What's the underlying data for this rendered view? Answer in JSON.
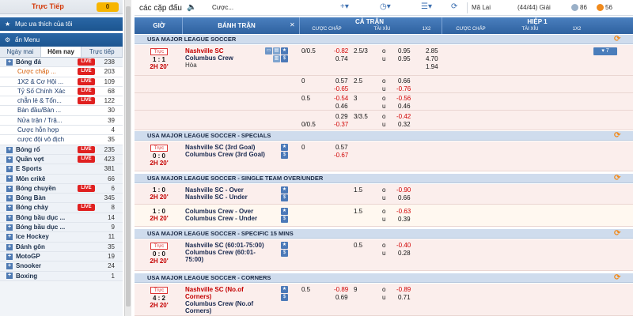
{
  "sidebar": {
    "live_tab": {
      "label": "Trực Tiếp",
      "count": "0"
    },
    "favorites_label": "Mục ưa thích của tôi",
    "menu_label": "ẩn Menu",
    "tabs": [
      "Ngày mai",
      "Hôm nay",
      "Trực tiếp"
    ],
    "sports": [
      {
        "label": "Bóng đá",
        "count": "238",
        "live": "LIVE",
        "kind": "main"
      },
      {
        "label": "Cược chấp ...",
        "count": "203",
        "live": "LIVE",
        "kind": "sub-active"
      },
      {
        "label": "1X2 & Cơ Hội ...",
        "count": "109",
        "live": "LIVE",
        "kind": "sub"
      },
      {
        "label": "Tỷ Số Chính Xác",
        "count": "68",
        "live": "LIVE",
        "kind": "sub"
      },
      {
        "label": "chẵn lẻ & Tổn...",
        "count": "122",
        "live": "LIVE",
        "kind": "sub"
      },
      {
        "label": "Bàn đầu/Bàn ...",
        "count": "30",
        "live": "",
        "kind": "sub"
      },
      {
        "label": "Nửa trận / Trậ...",
        "count": "39",
        "live": "",
        "kind": "sub"
      },
      {
        "label": "Cược hỗn hợp",
        "count": "4",
        "live": "",
        "kind": "sub"
      },
      {
        "label": "cược đội vô địch",
        "count": "35",
        "live": "",
        "kind": "sub"
      },
      {
        "label": "Bóng rổ",
        "count": "235",
        "live": "LIVE",
        "kind": "main"
      },
      {
        "label": "Quần vợt",
        "count": "423",
        "live": "LIVE",
        "kind": "main"
      },
      {
        "label": "E Sports",
        "count": "381",
        "live": "",
        "kind": "main"
      },
      {
        "label": "Môn crikê",
        "count": "66",
        "live": "",
        "kind": "main"
      },
      {
        "label": "Bóng chuyền",
        "count": "6",
        "live": "LIVE",
        "kind": "main"
      },
      {
        "label": "Bóng Bàn",
        "count": "345",
        "live": "",
        "kind": "main"
      },
      {
        "label": "Bóng chày",
        "count": "8",
        "live": "LIVE",
        "kind": "main"
      },
      {
        "label": "Bóng bầu dục ...",
        "count": "14",
        "live": "",
        "kind": "main"
      },
      {
        "label": "Bóng bầu dục ...",
        "count": "9",
        "live": "",
        "kind": "main"
      },
      {
        "label": "Ice Hockey",
        "count": "11",
        "live": "",
        "kind": "main"
      },
      {
        "label": "Đánh gôn",
        "count": "35",
        "live": "",
        "kind": "main"
      },
      {
        "label": "MotoGP",
        "count": "19",
        "live": "",
        "kind": "main"
      },
      {
        "label": "Snooker",
        "count": "24",
        "live": "",
        "kind": "main"
      },
      {
        "label": "Boxing",
        "count": "1",
        "live": "",
        "kind": "main"
      }
    ]
  },
  "topbar": {
    "title": "các cặp đấu",
    "bet_select": "Cược...",
    "odds_type": "Mã Lai",
    "match_count": "(44/44) Giải",
    "badge1": "86",
    "badge2": "56"
  },
  "header": {
    "time": "GIỜ",
    "match": "BÁNH TRẬN",
    "full_time": "CẢ TRẬN",
    "first_half": "HIỆP 1",
    "handicap": "CƯỢC CHẤP",
    "over_under": "TÀI XỈU",
    "one_x_two": "1X2",
    "handicap_h1": "CƯỢC CHẤP",
    "over_under_h1": "TÀI XỈU",
    "one_x_two_h1": "1X2"
  },
  "leagues": [
    {
      "name": "USA MAJOR LEAGUE SOCCER"
    },
    {
      "name": "USA MAJOR LEAGUE SOCCER - SPECIALS"
    },
    {
      "name": "USA MAJOR LEAGUE SOCCER - SINGLE TEAM OVER/UNDER"
    },
    {
      "name": "USA MAJOR LEAGUE SOCCER - SPECIFIC 15 MINS"
    },
    {
      "name": "USA MAJOR LEAGUE SOCCER - CORNERS"
    }
  ],
  "matches": [
    {
      "tv": "Trực",
      "score": "1 : 1",
      "time": "2H 20'",
      "home": "Nashville SC",
      "away": "Columbus Crew",
      "draw": "Hòa",
      "more": "▾ 7",
      "lines": [
        {
          "hdp": "0/0.5",
          "h_home": "-0.82",
          "ou": "2.5/3",
          "o": "o",
          "ou_home": "0.95",
          "x_1": "2.85",
          "h_away": "0.74",
          "u": "u",
          "ou_away": "0.95",
          "x_2": "4.70",
          "x_d": "1.94"
        },
        {
          "hdp": "0",
          "h_home": "0.57",
          "ou": "2.5",
          "o": "o",
          "ou_home": "0.66",
          "h_away": "-0.65",
          "u": "u",
          "ou_away": "-0.76"
        },
        {
          "hdp": "0.5",
          "h_home": "-0.54",
          "ou": "3",
          "o": "o",
          "ou_home": "-0.56",
          "h_away": "0.46",
          "u": "u",
          "ou_away": "0.46"
        },
        {
          "hdp": "0/0.5",
          "h_home": "0.29",
          "ou": "3/3.5",
          "o": "o",
          "ou_home": "-0.42",
          "h_away": "-0.37",
          "u": "u",
          "ou_away": "0.32"
        }
      ]
    },
    {
      "tv": "Trực",
      "score": "0 : 0",
      "time": "2H 20'",
      "home": "Nashville SC (3rd Goal)",
      "away": "Columbus Crew (3rd Goal)",
      "hdp": "0",
      "h_home": "0.57",
      "h_away": "-0.67"
    },
    {
      "score": "1 : 0",
      "time": "2H 20'",
      "home": "Nashville SC - Over",
      "away": "Nashville SC - Under",
      "ou": "1.5",
      "o": "o",
      "u": "u",
      "ou_home": "-0.90",
      "ou_away": "0.66"
    },
    {
      "score": "1 : 0",
      "time": "2H 20'",
      "home": "Columbus Crew - Over",
      "away": "Columbus Crew - Under",
      "ou": "1.5",
      "o": "o",
      "u": "u",
      "ou_home": "-0.63",
      "ou_away": "0.39"
    },
    {
      "tv": "Trực",
      "score": "0 : 0",
      "time": "2H 20'",
      "home": "Nashville SC (60:01-75:00)",
      "away": "Columbus Crew (60:01-75:00)",
      "ou": "0.5",
      "o": "o",
      "u": "u",
      "ou_home": "-0.40",
      "ou_away": "0.28"
    },
    {
      "tv": "Trực",
      "score": "4 : 2",
      "time": "2H 20'",
      "home": "Nashville SC (No.of Corners)",
      "away": "Columbus Crew (No.of Corners)",
      "hdp": "0.5",
      "h_home": "-0.89",
      "ou": "9",
      "o": "o",
      "u": "u",
      "h_away": "0.69",
      "ou_home": "-0.89",
      "ou_away": "0.71"
    }
  ],
  "colors": {
    "header_blue": "#2f62a0",
    "league_bg": "#cfdced",
    "live_red": "#e02020",
    "accent_orange": "#f08a1c"
  }
}
